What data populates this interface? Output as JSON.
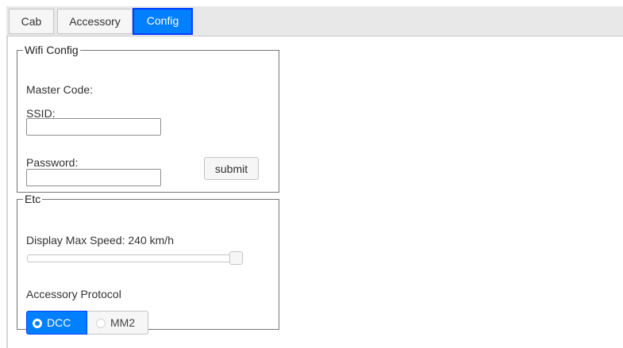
{
  "tabs": [
    {
      "label": "Cab",
      "active": false
    },
    {
      "label": "Accessory",
      "active": false
    },
    {
      "label": "Config",
      "active": true
    }
  ],
  "wifi": {
    "legend": "Wifi Config",
    "master_code_label": "Master Code:",
    "ssid_label": "SSID:",
    "ssid_value": "",
    "password_label": "Password:",
    "password_value": "",
    "submit_label": "submit"
  },
  "etc": {
    "legend": "Etc",
    "max_speed_label": "Display Max Speed: 240 km/h",
    "max_speed_slider": {
      "min": 0,
      "max": 240,
      "value": 240
    },
    "protocol_label": "Accessory Protocol",
    "protocol_options": [
      {
        "label": "DCC",
        "selected": true
      },
      {
        "label": "MM2",
        "selected": false
      }
    ]
  },
  "colors": {
    "accent": "#007fff",
    "accent_border": "#003eff",
    "tab_strip": "#e8e8e8"
  }
}
